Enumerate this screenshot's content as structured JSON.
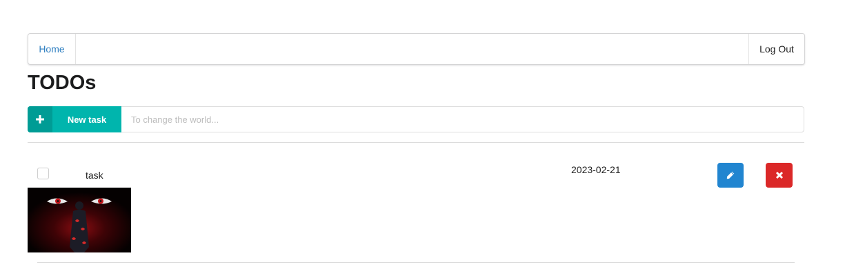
{
  "nav": {
    "home_label": "Home",
    "logout_label": "Log Out"
  },
  "page": {
    "title": "TODOs"
  },
  "new_task": {
    "button_label": "New task",
    "button_icon": "plus-icon",
    "input_placeholder": "To change the world...",
    "input_value": "",
    "color": "#00b5ad"
  },
  "tasks": [
    {
      "text": "task",
      "date": "2023-02-21",
      "checked": false,
      "has_image": true,
      "edit_icon": "pencil-icon",
      "delete_icon": "close-icon"
    }
  ],
  "colors": {
    "edit_button": "#2185d0",
    "delete_button": "#db2828",
    "link": "#2f7fc1"
  }
}
